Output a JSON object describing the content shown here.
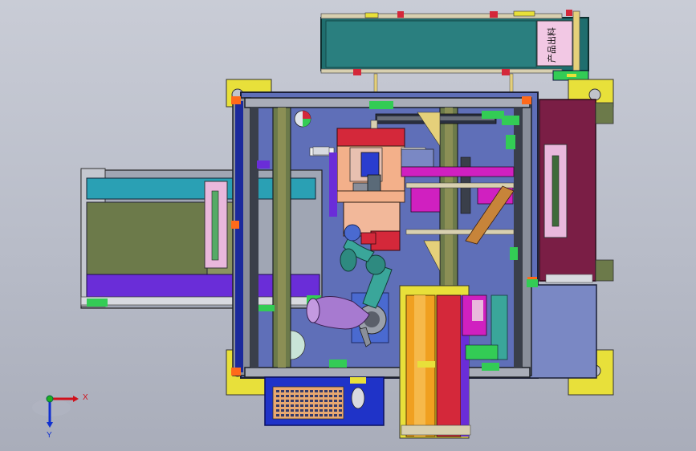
{
  "viewer": {
    "conveyor_label": "产品出料",
    "axes": {
      "x_label": "X",
      "y_label": "Y"
    },
    "colors": {
      "frame": "#3a3f4a",
      "frame_light": "#8a8f9a",
      "teal_conveyor": "#1f6e6e",
      "blue_plate": "#5f6fb8",
      "olive_belt": "#6c7a4a",
      "maroon_panel": "#7a1e45",
      "yellow_feet": "#e8e03a",
      "robot_teal": "#3aa69a",
      "robot_violet": "#a77ad0",
      "orange_slide": "#f0a020",
      "salmon_block": "#f3b08a",
      "red_block": "#d4283a",
      "magenta": "#d020c0",
      "purple_strip": "#6a2dd8"
    }
  }
}
